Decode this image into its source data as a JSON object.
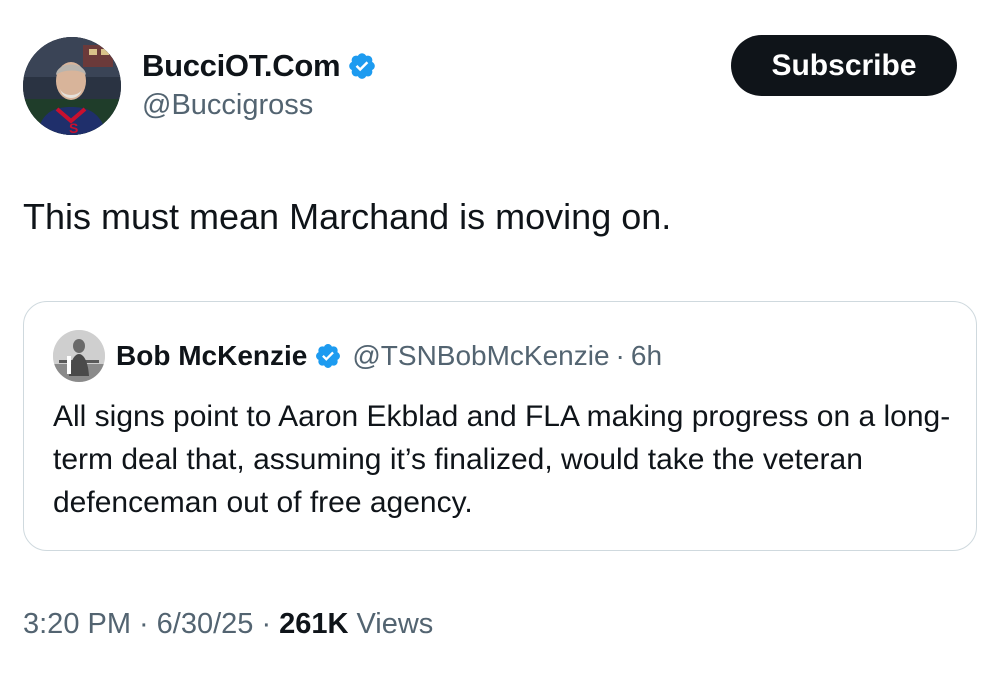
{
  "author": {
    "display_name": "BucciOT.Com",
    "handle": "@Buccigross",
    "verified": true
  },
  "subscribe_label": "Subscribe",
  "tweet_text": "This must mean Marchand is moving on.",
  "quote": {
    "display_name": "Bob McKenzie",
    "handle": "@TSNBobMcKenzie",
    "separator": "·",
    "time_ago": "6h",
    "verified": true,
    "text": "All signs point to Aaron Ekblad and FLA making progress on a long-term deal that, assuming it’s finalized, would take the veteran defenceman out of free agency."
  },
  "meta": {
    "time": "3:20 PM",
    "date": "6/30/25",
    "separator": "·",
    "views_count": "261K",
    "views_label": "Views"
  },
  "colors": {
    "primary_text": "#0f1419",
    "secondary_text": "#536471",
    "verified_blue": "#1d9bf0",
    "button_bg": "#0f1419",
    "card_border": "#cfd9de"
  },
  "icons": {
    "verified": "verified-badge-icon"
  }
}
